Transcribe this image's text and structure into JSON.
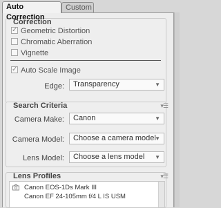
{
  "tabs": [
    {
      "label": "Auto Correction",
      "active": true
    },
    {
      "label": "Custom",
      "active": false
    }
  ],
  "correction": {
    "title": "Correction",
    "checkboxes": [
      {
        "label": "Geometric Distortion",
        "checked": true
      },
      {
        "label": "Chromatic Aberration",
        "checked": false
      },
      {
        "label": "Vignette",
        "checked": false
      },
      {
        "label": "Auto Scale Image",
        "checked": true
      }
    ],
    "edge_label": "Edge:",
    "edge_value": "Transparency"
  },
  "search_criteria": {
    "title": "Search Criteria",
    "camera_make_label": "Camera Make:",
    "camera_make_value": "Canon",
    "camera_model_label": "Camera Model:",
    "camera_model_value": "Choose a camera model",
    "lens_model_label": "Lens Model:",
    "lens_model_value": "Choose a lens model"
  },
  "lens_profiles": {
    "title": "Lens Profiles",
    "items": [
      {
        "camera": "Canon EOS-1Ds Mark III",
        "lens": "Canon EF 24-105mm f/4 L IS USM"
      }
    ]
  },
  "icons": {
    "checkmark": "check-icon",
    "dropdown": "chevron-down-icon",
    "section_menu": "panel-menu-icon",
    "lens_item": "camera-icon"
  },
  "colors": {
    "panel_bg": "#ededed",
    "window_bg": "#d7d7d7",
    "section_border": "#c8c8c8"
  }
}
